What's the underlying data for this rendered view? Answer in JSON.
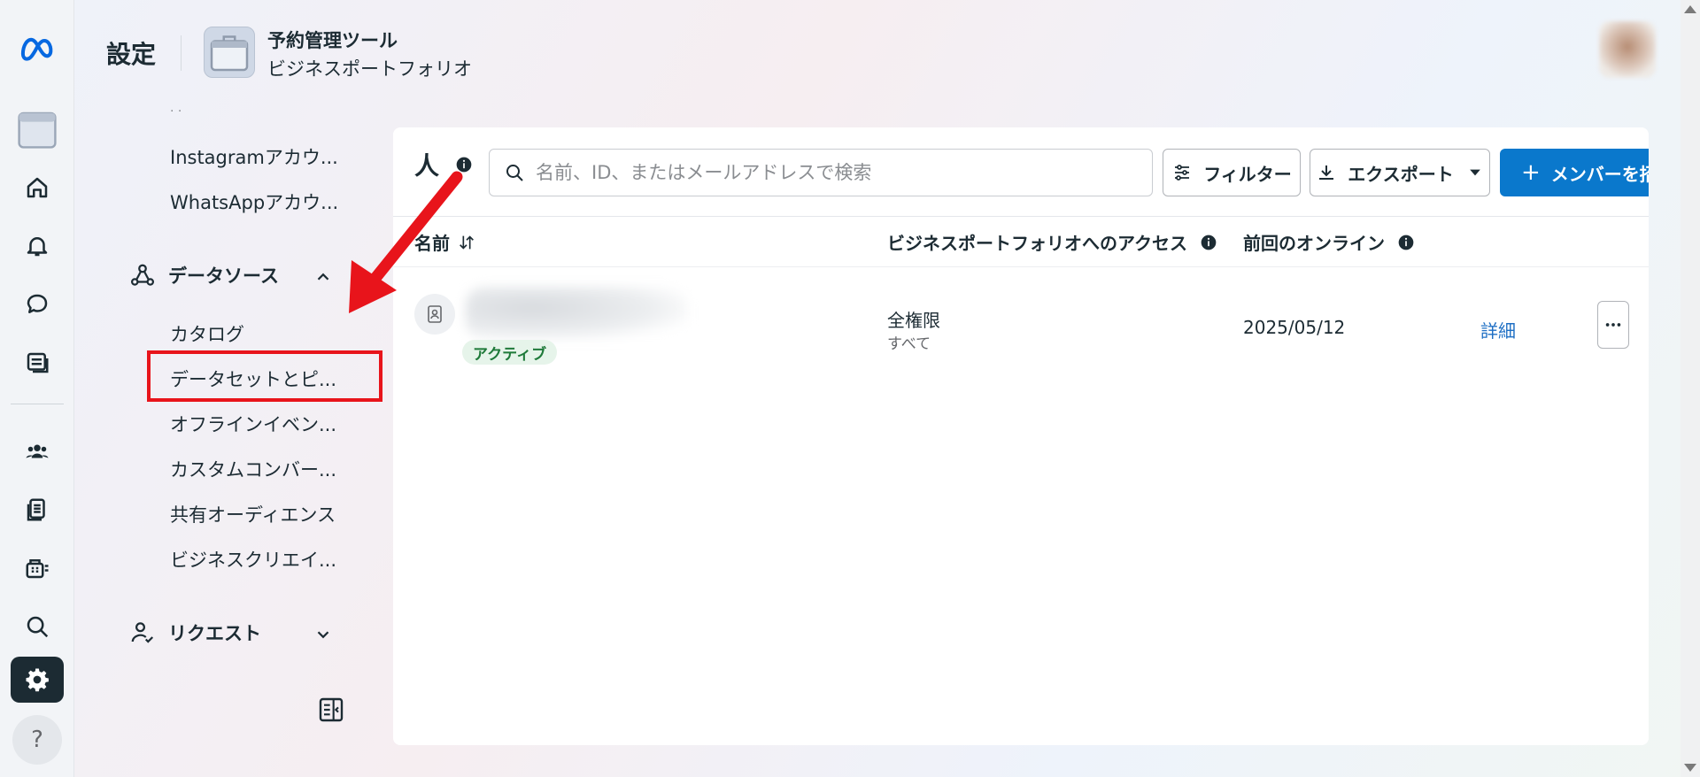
{
  "header": {
    "title": "設定",
    "portfolio_name": "予約管理ツール",
    "portfolio_type": "ビジネスポートフォリオ"
  },
  "sidebar": {
    "links_top": [
      {
        "label": "Instagramアカウ..."
      },
      {
        "label": "WhatsAppアカウ..."
      }
    ],
    "data_sources": {
      "label": "データソース",
      "items": [
        {
          "label": "カタログ"
        },
        {
          "label": "データセットとピ..."
        },
        {
          "label": "オフラインイベン..."
        },
        {
          "label": "カスタムコンバー..."
        },
        {
          "label": "共有オーディエンス"
        },
        {
          "label": "ビジネスクリエイ..."
        }
      ]
    },
    "requests": {
      "label": "リクエスト"
    }
  },
  "main": {
    "title": "人",
    "search_placeholder": "名前、ID、またはメールアドレスで検索",
    "filter_label": "フィルター",
    "export_label": "エクスポート",
    "invite_label": "メンバーを招待",
    "columns": {
      "name": "名前",
      "access": "ビジネスポートフォリオへのアクセス",
      "last_online": "前回のオンライン"
    },
    "rows": [
      {
        "status": "アクティブ",
        "access": "全権限",
        "access_detail": "すべて",
        "last_online": "2025/05/12",
        "detail_link": "詳細"
      }
    ]
  },
  "colors": {
    "primary": "#0a78cc",
    "highlight": "#e8141b",
    "active_badge": "#1f7a3a",
    "link": "#1e6fc4"
  },
  "rail_help": "?"
}
